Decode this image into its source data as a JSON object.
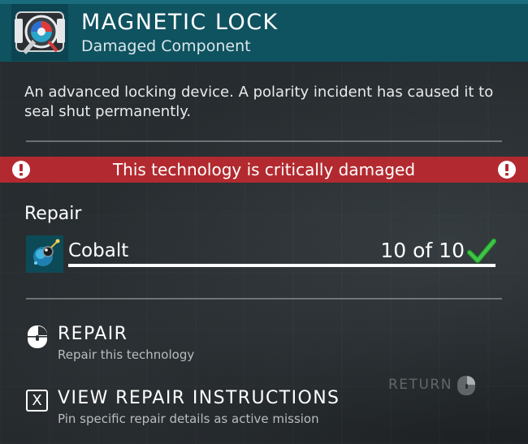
{
  "header": {
    "title": "MAGNETIC LOCK",
    "subtitle": "Damaged Component",
    "item_icon": "magnetic-lock-icon",
    "accent_color": "#0f5260"
  },
  "description": "An advanced locking device. A polarity incident has caused it to seal shut permanently.",
  "warning": {
    "text": "This technology is critically damaged",
    "icon": "exclamation-circle-icon",
    "color": "#b22a2f"
  },
  "repair": {
    "heading": "Repair",
    "resources": [
      {
        "name": "Cobalt",
        "quantity_text": "10 of 10",
        "have": 10,
        "need": 10,
        "progress": 1.0,
        "icon": "cobalt-icon",
        "status_icon": "checkmark-icon",
        "status_color": "#34c03c"
      }
    ]
  },
  "actions": [
    {
      "label": "REPAIR",
      "description": "Repair this technology",
      "icon": "mouse-left-click-icon"
    },
    {
      "label": "VIEW REPAIR INSTRUCTIONS",
      "description": "Pin specific repair details as active mission",
      "key": "X"
    }
  ],
  "return": {
    "label": "RETURN",
    "icon": "mouse-right-click-icon"
  }
}
